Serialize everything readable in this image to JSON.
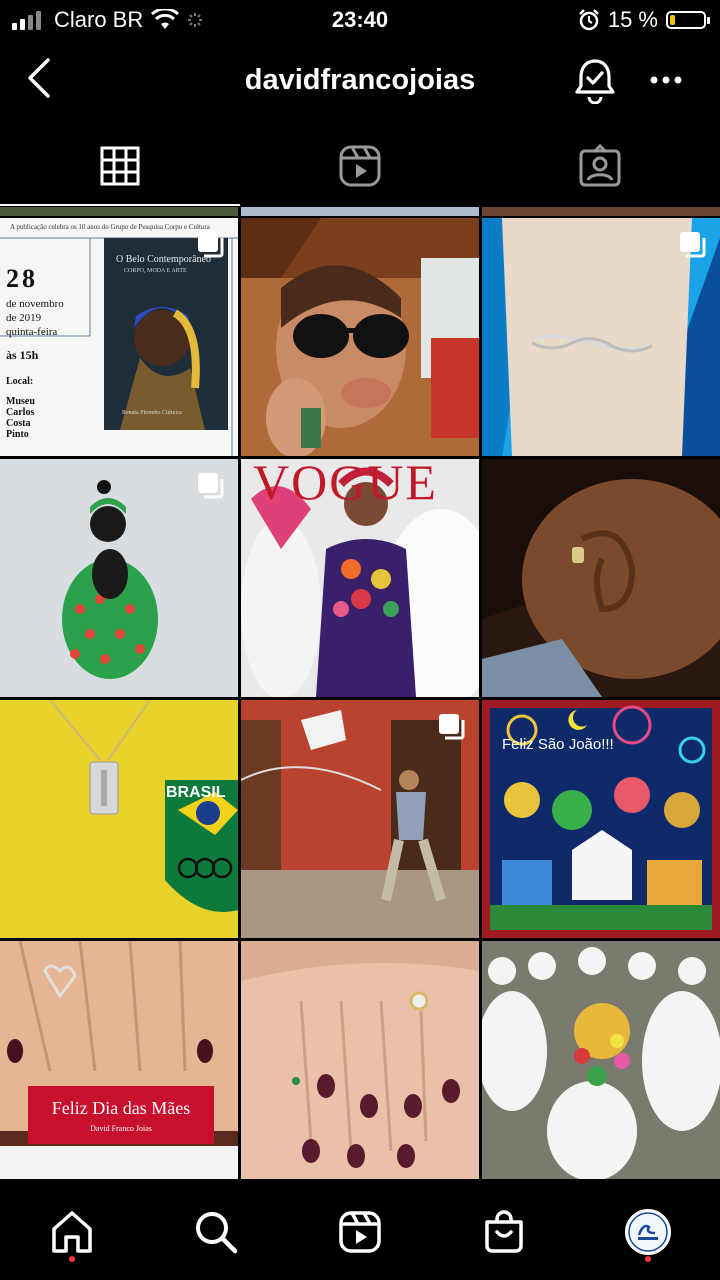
{
  "status_bar": {
    "carrier": "Claro BR",
    "time": "23:40",
    "battery_percent": "15 %",
    "battery_level": 0.15
  },
  "header": {
    "username": "davidfrancojoias"
  },
  "tabs": [
    {
      "icon": "grid-icon",
      "active": true
    },
    {
      "icon": "reels-icon",
      "active": false
    },
    {
      "icon": "tagged-icon",
      "active": false
    }
  ],
  "posts": {
    "p1": {
      "caption_top": "A publicação celebra os 10 anos do Grupo de Pesquisa Corpo e Cultura",
      "day": "28",
      "month": "de novembro",
      "year": "de 2019",
      "weekday": "quinta-feira",
      "time": "às 15h",
      "local_label": "Local:",
      "place1": "Museu",
      "place2": "Carlos",
      "place3": "Costa",
      "place4": "Pinto",
      "book_title": "O Belo Contemporâneo",
      "book_subtitle": "CORPO, MODA E ARTE",
      "book_author": "Renata Pitombo Cidreira"
    },
    "p5": {
      "magazine": "VOGUE"
    },
    "p7": {
      "brasil": "BRASIL"
    },
    "p9": {
      "greeting": "Feliz São João!!!"
    },
    "p10": {
      "title": "Feliz Dia das Mães",
      "brand": "David Franco Joias"
    }
  },
  "colors": {
    "background": "#000000",
    "notification_dot": "#ff3040",
    "battery": "#f5c400"
  }
}
